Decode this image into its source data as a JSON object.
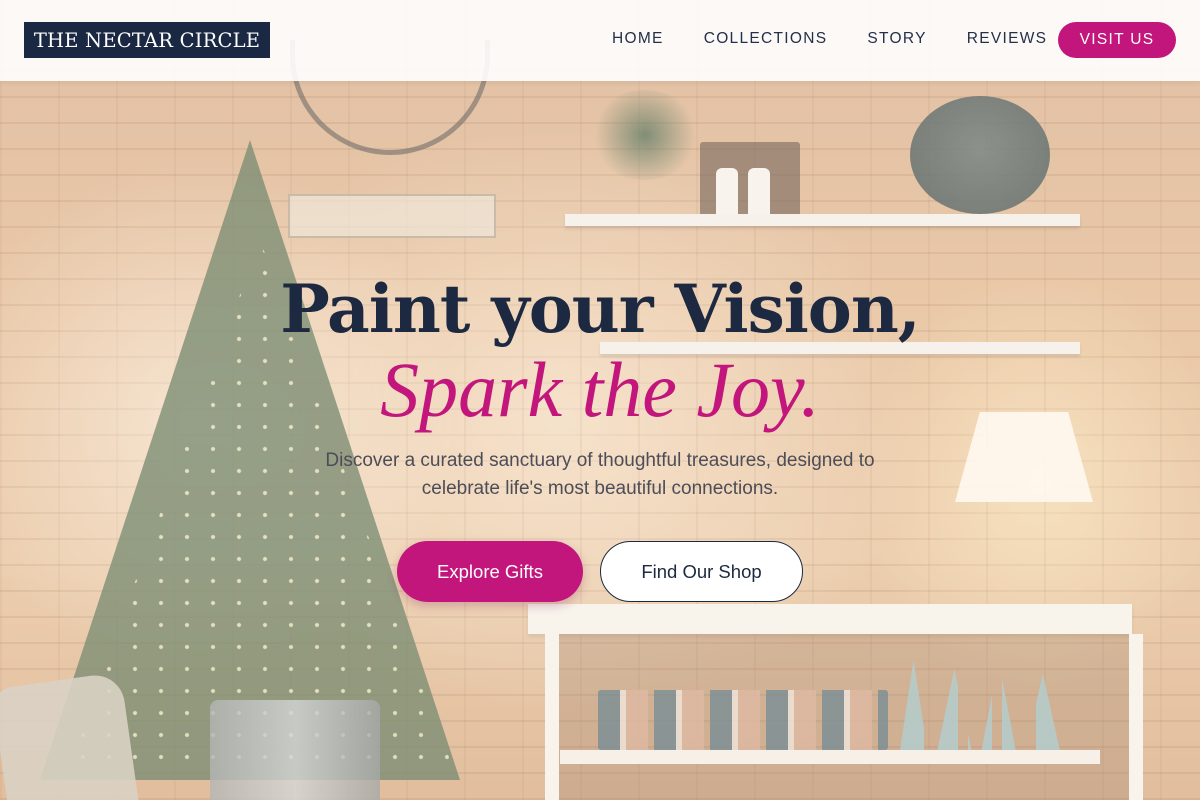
{
  "brand": {
    "name": "THE NECTAR CIRCLE",
    "logo_bg": "#1b2843"
  },
  "nav": {
    "links": [
      "HOME",
      "COLLECTIONS",
      "STORY",
      "REVIEWS"
    ],
    "cta_label": "VISIT US"
  },
  "hero": {
    "headline": "Paint your Vision,",
    "headline_accent": "Spark the Joy.",
    "subtitle": "Discover a curated sanctuary of thoughtful treasures, designed to celebrate life's most beautiful connections.",
    "primary_button": "Explore Gifts",
    "secondary_button": "Find Our Shop"
  },
  "colors": {
    "accent": "#c2167c",
    "navy": "#1c2940",
    "nav_background": "#ffffff"
  },
  "background": {
    "description_icon": "holiday-shop-photo"
  }
}
